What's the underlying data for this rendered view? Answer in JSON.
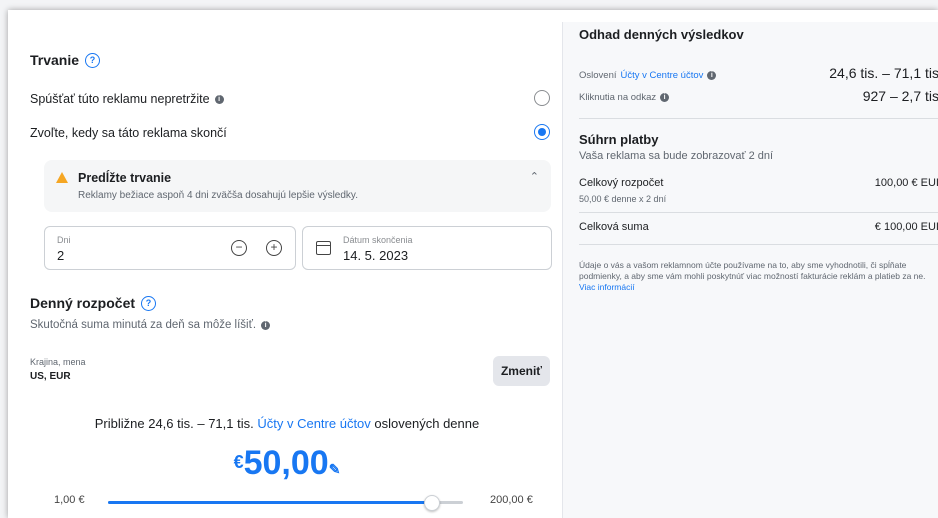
{
  "left": {
    "duration": {
      "title": "Trvanie",
      "option_continuous": "Spúšťať túto reklamu nepretržite",
      "option_end": "Zvoľte, kedy sa táto reklama skončí",
      "selected": "end"
    },
    "warning": {
      "title": "Predĺžte trvanie",
      "text": "Reklamy bežiace aspoň 4 dni zväčša dosahujú lepšie výsledky."
    },
    "days_field": {
      "label": "Dni",
      "value": "2",
      "minus_icon": "minus-circle-icon",
      "plus_icon": "plus-circle-icon"
    },
    "end_date_field": {
      "label": "Dátum skončenia",
      "value": "14. 5. 2023",
      "icon": "calendar-icon"
    },
    "daily_budget": {
      "title": "Denný rozpočet",
      "subtitle": "Skutočná suma minutá za deň sa môže líšiť.",
      "country_label": "Krajina, mena",
      "country_value": "US, EUR",
      "change_button": "Zmeniť",
      "reach_prefix": "Približne 24,6 tis. – 71,1 tis.",
      "reach_link": "Účty v Centre účtov",
      "reach_suffix": "oslovených denne",
      "currency_symbol": "€",
      "amount": "50,00",
      "slider_min": "1,00 €",
      "slider_max": "200,00 €",
      "slider_fraction": 0.91
    }
  },
  "right": {
    "title": "Odhad denných výsledkov",
    "reach": {
      "label_prefix": "Oslovení",
      "label_link": "Účty v Centre účtov",
      "value": "24,6 tis. – 71,1 tis"
    },
    "clicks": {
      "label": "Kliknutia na odkaz",
      "value": "927 – 2,7 tis"
    },
    "summary": {
      "title": "Súhrn platby",
      "subtitle": "Vaša reklama sa bude zobrazovať 2 dní",
      "total_budget_label": "Celkový rozpočet",
      "total_budget_detail": "50,00 € denne x 2 dní",
      "total_budget_value": "100,00 € EUI",
      "total_sum_label": "Celková suma",
      "total_sum_value": "€ 100,00 EUI"
    },
    "disclaimer": "Údaje o vás a vašom reklamnom účte používame na to, aby sme vyhodnotili, či spĺňate podmienky, a aby sme vám mohli poskytnúť viac možností fakturácie reklám a platieb za ne.",
    "disclaimer_link": "Viac informácií"
  },
  "colors": {
    "accent": "#1877f2",
    "warning": "#f5a623"
  }
}
